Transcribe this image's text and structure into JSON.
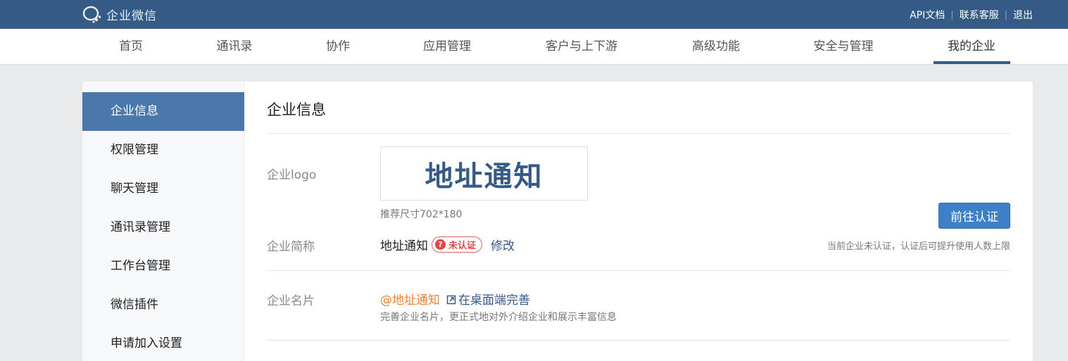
{
  "topbar": {
    "brand": "企业微信",
    "links": [
      "API文档",
      "联系客服",
      "退出"
    ]
  },
  "nav": {
    "items": [
      "首页",
      "通讯录",
      "协作",
      "应用管理",
      "客户与上下游",
      "高级功能",
      "安全与管理",
      "我的企业"
    ],
    "active": "我的企业"
  },
  "sidebar": {
    "items": [
      "企业信息",
      "权限管理",
      "聊天管理",
      "通讯录管理",
      "工作台管理",
      "微信插件",
      "申请加入设置"
    ],
    "active": "企业信息"
  },
  "main": {
    "title": "企业信息",
    "logo": {
      "label": "企业logo",
      "logo_text": "地址通知",
      "hint": "推荐尺寸702*180"
    },
    "short_name": {
      "label": "企业简称",
      "value": "地址通知",
      "badge": "未认证",
      "edit": "修改"
    },
    "verify": {
      "button": "前往认证",
      "hint": "当前企业未认证，认证后可提升使用人数上限"
    },
    "business_card": {
      "label": "企业名片",
      "name": "@地址通知",
      "link": "在桌面端完善",
      "hint": "完善企业名片，更正式地对外介绍企业和展示丰富信息"
    }
  },
  "colors": {
    "topbar": "#345a85",
    "sidebar_active": "#4a78ad",
    "button": "#3d80c8",
    "badge": "#e04848",
    "orange": "#e8823a"
  },
  "icons": [
    "wecom-logo-icon",
    "question-circle-icon",
    "external-link-icon"
  ]
}
